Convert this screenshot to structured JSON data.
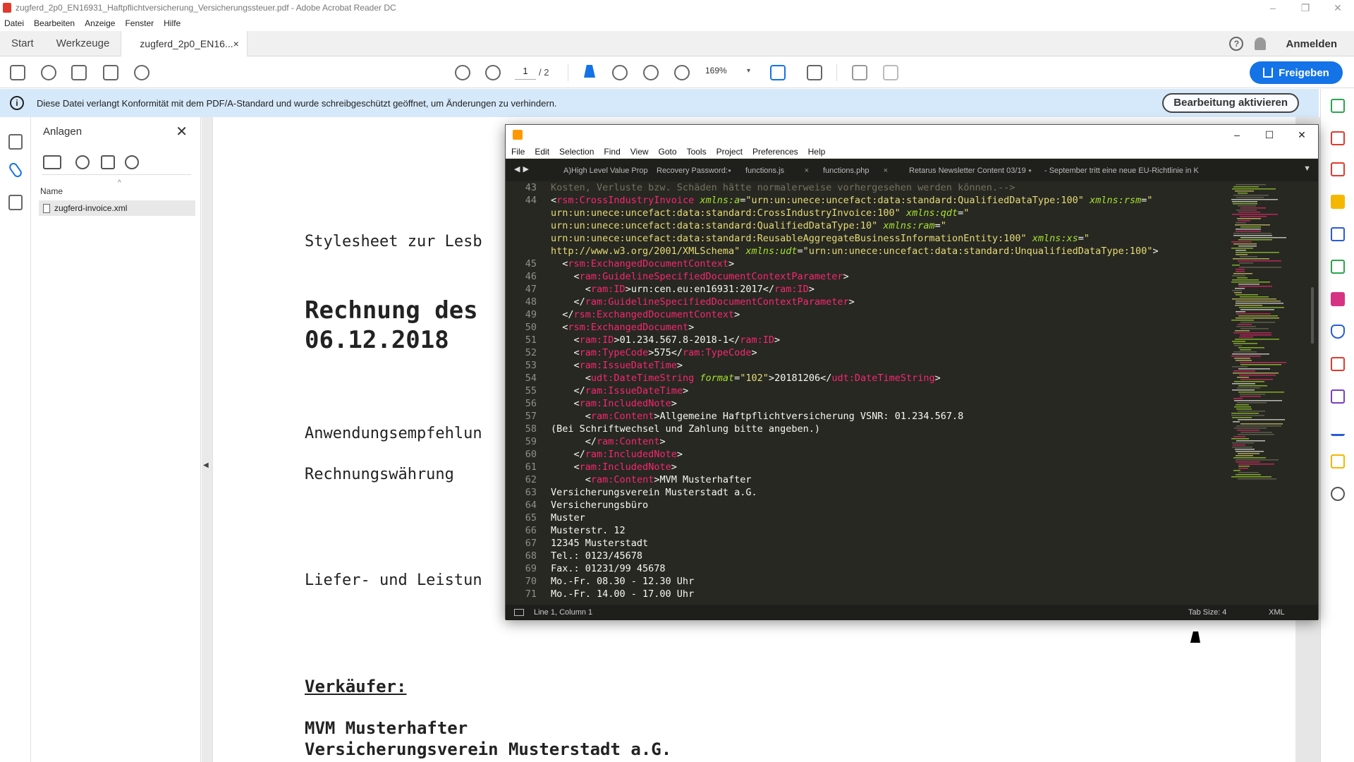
{
  "acrobat": {
    "title": "zugferd_2p0_EN16931_Haftpflichtversicherung_Versicherungssteuer.pdf - Adobe Acrobat Reader DC",
    "menu": [
      "Datei",
      "Bearbeiten",
      "Anzeige",
      "Fenster",
      "Hilfe"
    ],
    "tabs": {
      "start": "Start",
      "tools": "Werkzeuge",
      "doc": "zugferd_2p0_EN16...",
      "doc_close": "×"
    },
    "login": "Anmelden",
    "toolbar": {
      "page_current": "1",
      "page_total": "/ 2",
      "zoom": "169%"
    },
    "share_button": "Freigeben",
    "banner": {
      "message": "Diese Datei verlangt Konformität mit dem PDF/A-Standard und wurde schreibgeschützt geöffnet, um Änderungen zu verhindern.",
      "button": "Bearbeitung aktivieren"
    },
    "attachments": {
      "title": "Anlagen",
      "column_name": "Name",
      "files": [
        "zugferd-invoice.xml"
      ]
    },
    "document": {
      "line1": "Stylesheet zur Lesb",
      "heading1": "Rechnung des",
      "heading2": "06.12.2018",
      "line2": "Anwendungsempfehlun",
      "line3": "Rechnungswährung",
      "line4": "Liefer- und Leistun",
      "seller_label": "Verkäufer:",
      "seller1": "MVM Musterhafter",
      "seller2": "Versicherungsverein Musterstadt a.G."
    }
  },
  "sublime": {
    "menu": [
      "File",
      "Edit",
      "Selection",
      "Find",
      "View",
      "Goto",
      "Tools",
      "Project",
      "Preferences",
      "Help"
    ],
    "tabs": [
      {
        "label": "A)High Level Value Prop für Endkı",
        "close": ""
      },
      {
        "label": "Recovery Password:",
        "close": "●"
      },
      {
        "label": "functions.js",
        "close": "×"
      },
      {
        "label": "functions.php",
        "close": "×"
      },
      {
        "label": "Retarus Newsletter Content 03/19",
        "close": "●"
      },
      {
        "label": "- September tritt eine neue EU-Richtlinie in K",
        "close": ""
      }
    ],
    "code": [
      {
        "n": "43",
        "html": "<span class='cmt'>Kosten, Verluste bzw. Schäden hätte normalerweise vorhergesehen werden können.--&gt;</span>"
      },
      {
        "n": "44",
        "html": "<span class='txt'>&lt;</span><span class='tag'>rsm:CrossIndustryInvoice</span> <span class='attr'>xmlns:a</span><span class='txt'>=</span><span class='str'>\"urn:un:unece:uncefact:data:standard:QualifiedDataType:100\"</span> <span class='attr'>xmlns:rsm</span><span class='txt'>=</span><span class='str'>\"</span>"
      },
      {
        "n": "",
        "html": "<span class='str'>urn:un:unece:uncefact:data:standard:CrossIndustryInvoice:100\"</span> <span class='attr'>xmlns:qdt</span><span class='txt'>=</span><span class='str'>\"</span>"
      },
      {
        "n": "",
        "html": "<span class='str'>urn:un:unece:uncefact:data:standard:QualifiedDataType:10\"</span> <span class='attr'>xmlns:ram</span><span class='txt'>=</span><span class='str'>\"</span>"
      },
      {
        "n": "",
        "html": "<span class='str'>urn:un:unece:uncefact:data:standard:ReusableAggregateBusinessInformationEntity:100\"</span> <span class='attr'>xmlns:xs</span><span class='txt'>=</span><span class='str'>\"</span>"
      },
      {
        "n": "",
        "html": "<span class='str'>http://www.w3.org/2001/XMLSchema\"</span> <span class='attr'>xmlns:udt</span><span class='txt'>=</span><span class='str'>\"urn:un:unece:uncefact:data:standard:UnqualifiedDataType:100\"</span><span class='txt'>&gt;</span>"
      },
      {
        "n": "45",
        "html": "  <span class='txt'>&lt;</span><span class='tag'>rsm:ExchangedDocumentContext</span><span class='txt'>&gt;</span>"
      },
      {
        "n": "46",
        "html": "    <span class='txt'>&lt;</span><span class='tag'>ram:GuidelineSpecifiedDocumentContextParameter</span><span class='txt'>&gt;</span>"
      },
      {
        "n": "47",
        "html": "      <span class='txt'>&lt;</span><span class='tag'>ram:ID</span><span class='txt'>&gt;urn:cen.eu:en16931:2017&lt;/</span><span class='tag'>ram:ID</span><span class='txt'>&gt;</span>"
      },
      {
        "n": "48",
        "html": "    <span class='txt'>&lt;/</span><span class='tag'>ram:GuidelineSpecifiedDocumentContextParameter</span><span class='txt'>&gt;</span>"
      },
      {
        "n": "49",
        "html": "  <span class='txt'>&lt;/</span><span class='tag'>rsm:ExchangedDocumentContext</span><span class='txt'>&gt;</span>"
      },
      {
        "n": "50",
        "html": "  <span class='txt'>&lt;</span><span class='tag'>rsm:ExchangedDocument</span><span class='txt'>&gt;</span>"
      },
      {
        "n": "51",
        "html": "    <span class='txt'>&lt;</span><span class='tag'>ram:ID</span><span class='txt'>&gt;01.234.567.8-2018-1&lt;/</span><span class='tag'>ram:ID</span><span class='txt'>&gt;</span>"
      },
      {
        "n": "52",
        "html": "    <span class='txt'>&lt;</span><span class='tag'>ram:TypeCode</span><span class='txt'>&gt;575&lt;/</span><span class='tag'>ram:TypeCode</span><span class='txt'>&gt;</span>"
      },
      {
        "n": "53",
        "html": "    <span class='txt'>&lt;</span><span class='tag'>ram:IssueDateTime</span><span class='txt'>&gt;</span>"
      },
      {
        "n": "54",
        "html": "      <span class='txt'>&lt;</span><span class='tag'>udt:DateTimeString</span> <span class='attr'>format</span><span class='txt'>=</span><span class='str'>\"102\"</span><span class='txt'>&gt;20181206&lt;/</span><span class='tag'>udt:DateTimeString</span><span class='txt'>&gt;</span>"
      },
      {
        "n": "55",
        "html": "    <span class='txt'>&lt;/</span><span class='tag'>ram:IssueDateTime</span><span class='txt'>&gt;</span>"
      },
      {
        "n": "56",
        "html": "    <span class='txt'>&lt;</span><span class='tag'>ram:IncludedNote</span><span class='txt'>&gt;</span>"
      },
      {
        "n": "57",
        "html": "      <span class='txt'>&lt;</span><span class='tag'>ram:Content</span><span class='txt'>&gt;Allgemeine Haftpflichtversicherung VSNR: 01.234.567.8</span>"
      },
      {
        "n": "58",
        "html": "<span class='txt'>(Bei Schriftwechsel und Zahlung bitte angeben.)</span>"
      },
      {
        "n": "59",
        "html": "      <span class='txt'>&lt;/</span><span class='tag'>ram:Content</span><span class='txt'>&gt;</span>"
      },
      {
        "n": "60",
        "html": "    <span class='txt'>&lt;/</span><span class='tag'>ram:IncludedNote</span><span class='txt'>&gt;</span>"
      },
      {
        "n": "61",
        "html": "    <span class='txt'>&lt;</span><span class='tag'>ram:IncludedNote</span><span class='txt'>&gt;</span>"
      },
      {
        "n": "62",
        "html": "      <span class='txt'>&lt;</span><span class='tag'>ram:Content</span><span class='txt'>&gt;MVM Musterhafter</span>"
      },
      {
        "n": "63",
        "html": "<span class='txt'>Versicherungsverein Musterstadt a.G.</span>"
      },
      {
        "n": "64",
        "html": "<span class='txt'>Versicherungsbüro</span>"
      },
      {
        "n": "65",
        "html": "<span class='txt'>Muster</span>"
      },
      {
        "n": "66",
        "html": "<span class='txt'>Musterstr. 12</span>"
      },
      {
        "n": "67",
        "html": "<span class='txt'>12345 Musterstadt</span>"
      },
      {
        "n": "68",
        "html": "<span class='txt'>Tel.: 0123/45678</span>"
      },
      {
        "n": "69",
        "html": "<span class='txt'>Fax.: 01231/99 45678</span>"
      },
      {
        "n": "70",
        "html": "<span class='txt'>Mo.-Fr. 08.30 - 12.30 Uhr</span>"
      },
      {
        "n": "71",
        "html": "<span class='txt'>Mo.-Fr. 14.00 - 17.00 Uhr</span>"
      }
    ],
    "status": {
      "position": "Line 1, Column 1",
      "tab_size": "Tab Size: 4",
      "syntax": "XML"
    }
  }
}
